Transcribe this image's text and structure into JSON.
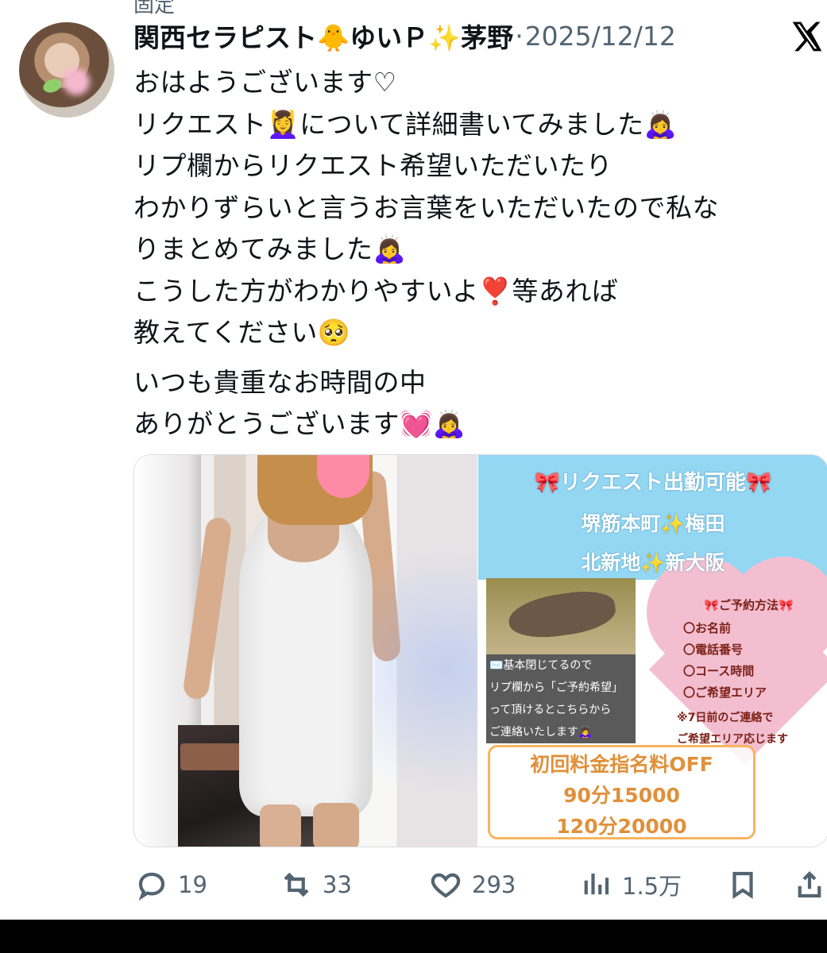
{
  "top_partial": "固定",
  "tweet": {
    "author": "関西セラピスト🐥ゆいＰ✨茅野",
    "separator": "·",
    "date": "2025/12/12",
    "lines": [
      "おはようございます♡",
      "リクエスト💆‍♀️について詳細書いてみました🙇‍♀️",
      "リプ欄からリクエスト希望いただいたり",
      "わかりずらいと言うお言葉をいただいたので私な",
      "りまとめてみました🙇‍♀️",
      "こうした方がわかりやすいよ❣️等あれば",
      "教えてください🥺"
    ],
    "lines2": [
      "いつも貴重なお時間の中",
      "ありがとうございます💓🙇‍♀️"
    ]
  },
  "image_card": {
    "title": "🎀リクエスト出勤可能🎀",
    "line1": "堺筋本町✨梅田",
    "line2": "北新地✨新大阪",
    "howto_title": "🎀ご予約方法🎀",
    "howto_items": [
      "〇お名前",
      "〇電話番号",
      "〇コース時間",
      "〇ご希望エリア"
    ],
    "notice": [
      "※7日前のご連絡で",
      "ご希望エリア応じます"
    ],
    "left_text": [
      "✉️基本閉じてるので",
      "リプ欄から「ご予約希望」",
      "って頂けるとこちらから",
      "ご連絡いたします🙇‍♀️"
    ],
    "price_lines": [
      "初回料金指名料OFF",
      "90分15000",
      "120分20000"
    ]
  },
  "actions": {
    "reply_count": "19",
    "retweet_count": "33",
    "like_count": "293",
    "view_count": "1.5万"
  },
  "icons": [
    "x-logo-icon",
    "reply-icon",
    "retweet-icon",
    "like-icon",
    "views-icon",
    "bookmark-icon",
    "share-icon"
  ]
}
